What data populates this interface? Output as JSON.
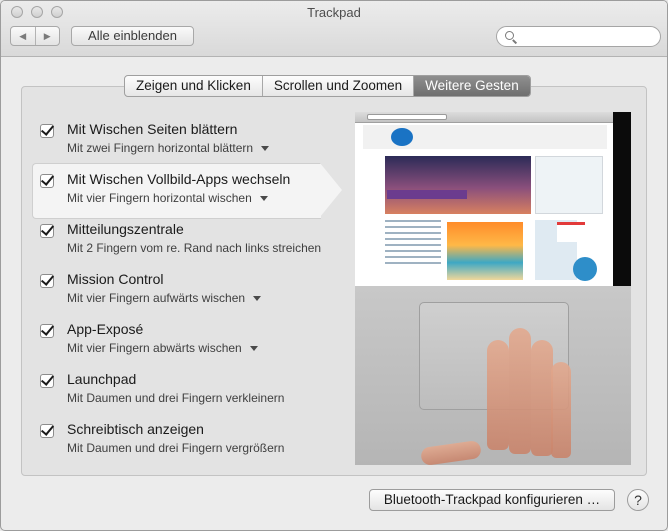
{
  "window": {
    "title": "Trackpad"
  },
  "toolbar": {
    "back_glyph": "◀",
    "forward_glyph": "▶",
    "show_all_label": "Alle einblenden",
    "search": {
      "value": "",
      "placeholder": ""
    }
  },
  "tabs": [
    {
      "label": "Zeigen und Klicken",
      "active": false
    },
    {
      "label": "Scrollen und Zoomen",
      "active": false
    },
    {
      "label": "Weitere Gesten",
      "active": true
    }
  ],
  "gestures": [
    {
      "title": "Mit Wischen Seiten blättern",
      "subtitle": "Mit zwei Fingern horizontal blättern",
      "checked": true,
      "has_menu": true,
      "selected": false
    },
    {
      "title": "Mit Wischen Vollbild-Apps wechseln",
      "subtitle": "Mit vier Fingern horizontal wischen",
      "checked": true,
      "has_menu": true,
      "selected": true
    },
    {
      "title": "Mitteilungszentrale",
      "subtitle": "Mit 2 Fingern vom re. Rand nach links streichen",
      "checked": true,
      "has_menu": false,
      "selected": false
    },
    {
      "title": "Mission Control",
      "subtitle": "Mit vier Fingern aufwärts wischen",
      "checked": true,
      "has_menu": true,
      "selected": false
    },
    {
      "title": "App-Exposé",
      "subtitle": "Mit vier Fingern abwärts wischen",
      "checked": true,
      "has_menu": true,
      "selected": false
    },
    {
      "title": "Launchpad",
      "subtitle": "Mit Daumen und drei Fingern verkleinern",
      "checked": true,
      "has_menu": false,
      "selected": false
    },
    {
      "title": "Schreibtisch anzeigen",
      "subtitle": "Mit Daumen und drei Fingern vergrößern",
      "checked": true,
      "has_menu": false,
      "selected": false
    }
  ],
  "bottom": {
    "bluetooth_label": "Bluetooth-Trackpad konfigurieren …",
    "help_label": "?"
  }
}
